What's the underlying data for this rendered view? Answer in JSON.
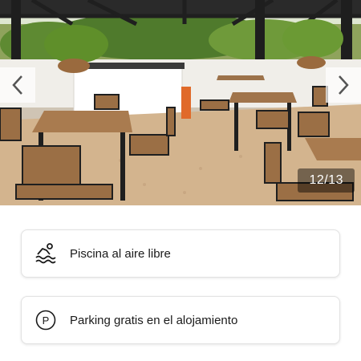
{
  "carousel": {
    "counter": "12/13",
    "prev_icon": "chevron-left-icon",
    "next_icon": "chevron-right-icon"
  },
  "amenities": [
    {
      "icon": "pool-icon",
      "label": "Piscina al aire libre"
    },
    {
      "icon": "parking-icon",
      "label": "Parking gratis en el alojamiento"
    }
  ],
  "colors": {
    "card_border": "#e2e2e2",
    "text": "#1a1a1a",
    "counter_bg": "rgba(0,0,0,0.45)"
  }
}
